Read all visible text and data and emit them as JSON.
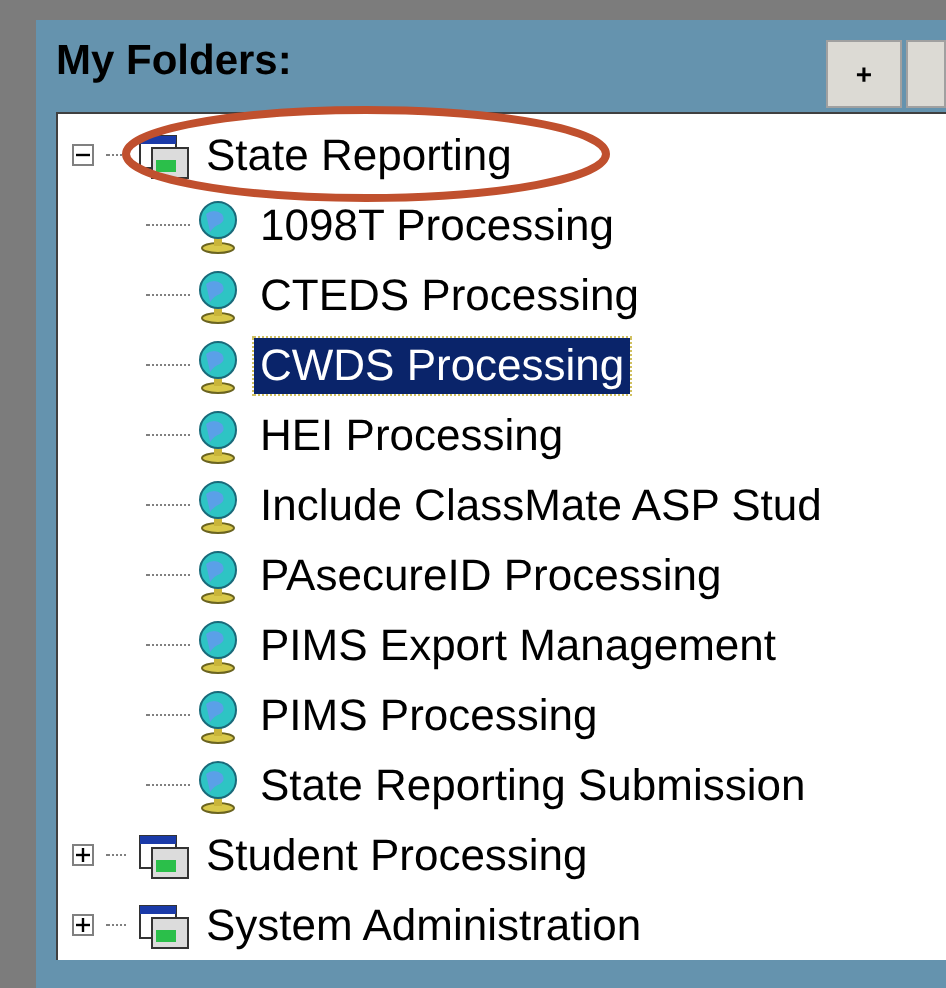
{
  "panel": {
    "title": "My Folders:",
    "buttons": [
      "+"
    ]
  },
  "tree": [
    {
      "label": "State Reporting",
      "expanded": true,
      "selected": false,
      "children": [
        {
          "label": "1098T Processing",
          "selected": false
        },
        {
          "label": "CTEDS Processing",
          "selected": false
        },
        {
          "label": "CWDS Processing",
          "selected": true
        },
        {
          "label": "HEI Processing",
          "selected": false
        },
        {
          "label": "Include ClassMate ASP Stud",
          "selected": false
        },
        {
          "label": "PAsecureID Processing",
          "selected": false
        },
        {
          "label": "PIMS Export Management",
          "selected": false
        },
        {
          "label": "PIMS Processing",
          "selected": false
        },
        {
          "label": "State Reporting Submission",
          "selected": false
        }
      ]
    },
    {
      "label": "Student Processing",
      "expanded": false,
      "selected": false
    },
    {
      "label": "System Administration",
      "expanded": false,
      "selected": false
    }
  ]
}
